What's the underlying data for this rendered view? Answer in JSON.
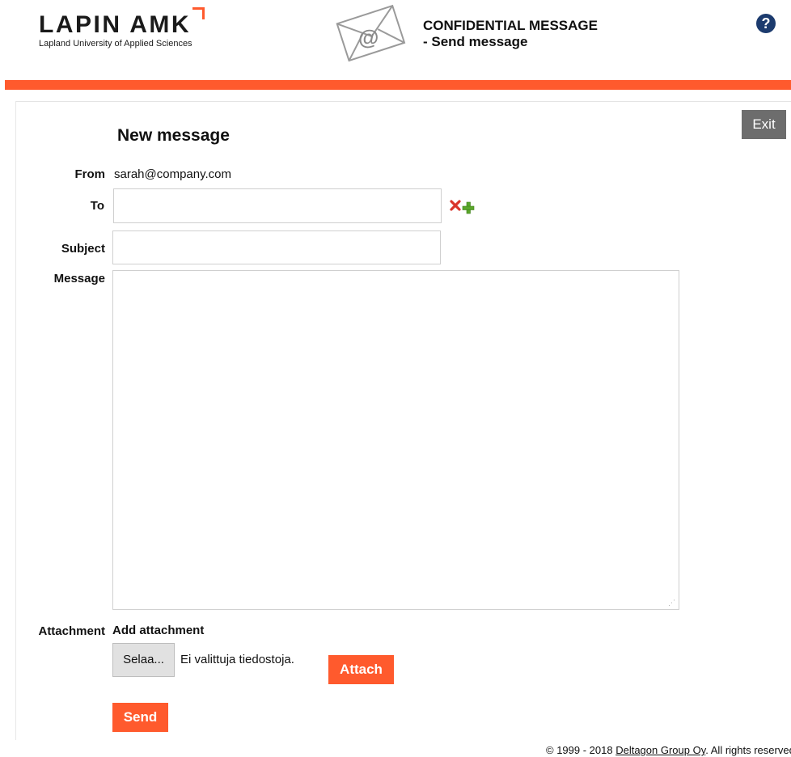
{
  "header": {
    "logo_main": "LAPIN AMK",
    "logo_sub": "Lapland University of Applied Sciences",
    "title_line1": "CONFIDENTIAL MESSAGE",
    "title_line2": "- Send message",
    "help_label": "?"
  },
  "toolbar": {
    "exit_label": "Exit"
  },
  "form": {
    "page_title": "New message",
    "from_label": "From",
    "from_value": "sarah@company.com",
    "to_label": "To",
    "to_value": "",
    "subject_label": "Subject",
    "subject_value": "",
    "message_label": "Message",
    "message_value": "",
    "attachment_label": "Attachment",
    "add_attachment_label": "Add attachment",
    "browse_label": "Selaa...",
    "no_file_text": "Ei valittuja tiedostoja.",
    "attach_label": "Attach",
    "send_label": "Send"
  },
  "footer": {
    "prefix": "© 1999 - 2018 ",
    "link": "Deltagon Group Oy",
    "suffix": ". All rights reserved"
  },
  "colors": {
    "accent": "#ff5a2d",
    "exit_bg": "#6d6d6d",
    "help_bg": "#1c3b6e"
  },
  "icons": [
    "envelope-at-icon",
    "help-icon",
    "remove-recipient-icon",
    "add-recipient-icon"
  ]
}
